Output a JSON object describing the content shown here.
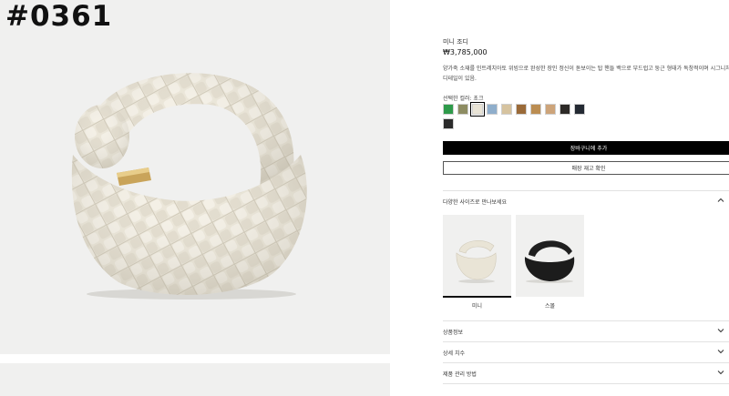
{
  "gallery": {
    "code_label": "#0361"
  },
  "product": {
    "name": "미니 조디",
    "price": "₩3,785,000",
    "description": "양가죽 소재를 인트레치아토 위빙으로 완성한 장인 정신이 돋보이는 탑 핸들 백으로 부드럽고 둥근 형태가 독창적이며 시그니처 노 디테일이 있음."
  },
  "colors": {
    "title": "선택한 컬러: 초크",
    "swatches": [
      "#2e9a4a",
      "#8d8c62",
      "#e9e4d6",
      "#8faecb",
      "#d6c39f",
      "#9a6a38",
      "#bb8d52",
      "#cda47a",
      "#2d2a27",
      "#242a33",
      "#2b2b2b"
    ],
    "selected_index": 2
  },
  "actions": {
    "add_to_cart": "장바구니에 추가",
    "check_stock": "매장 재고 확인"
  },
  "sizes": {
    "title": "다양한 사이즈로 만나보세요",
    "items": [
      {
        "label": "미니",
        "color": "#e9e4d6"
      },
      {
        "label": "스몰",
        "color": "#1c1c1c"
      }
    ]
  },
  "accordion": {
    "items": [
      "상품정보",
      "상세 치수",
      "제품 관리 방법"
    ]
  }
}
